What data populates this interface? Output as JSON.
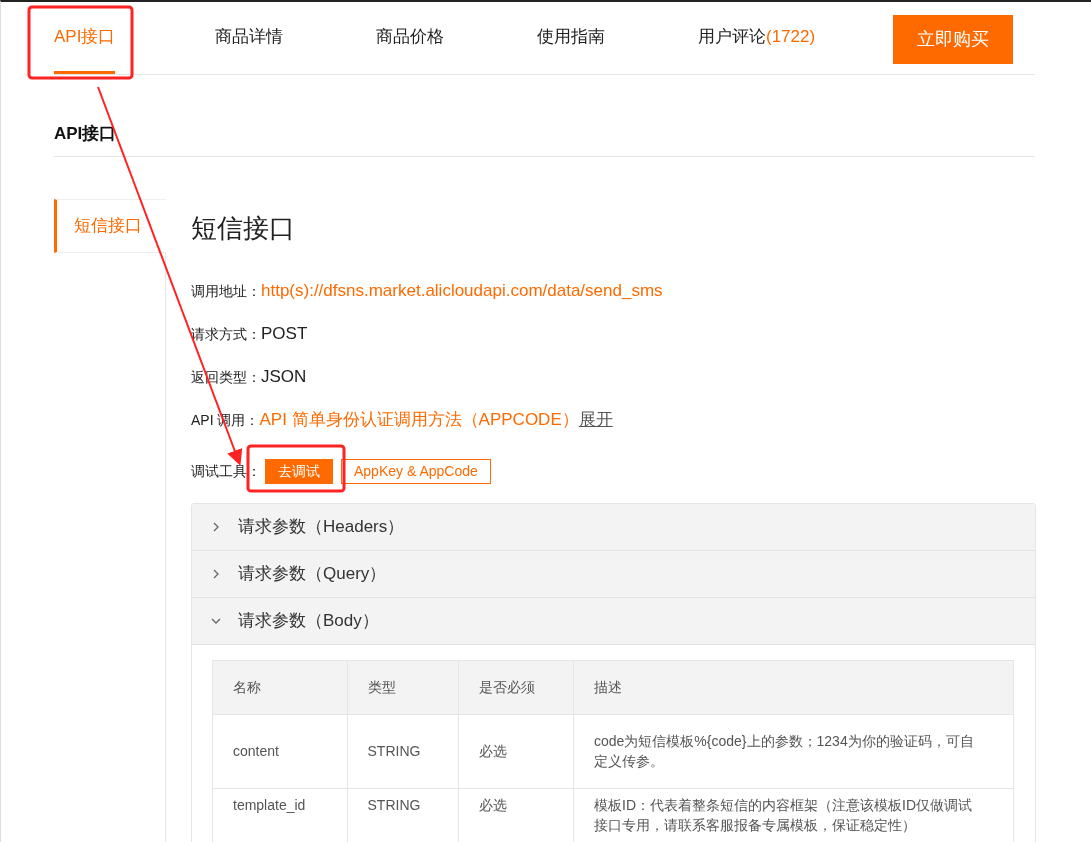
{
  "nav": {
    "tabs": [
      {
        "label": "API接口",
        "selected": true
      },
      {
        "label": "商品详情",
        "selected": false
      },
      {
        "label": "商品价格",
        "selected": false
      },
      {
        "label": "使用指南",
        "selected": false
      },
      {
        "label": "用户评论",
        "count": "(1722)",
        "selected": false
      }
    ],
    "buy_button": "立即购买"
  },
  "section_title": "API接口",
  "sidebar": {
    "items": [
      {
        "label": "短信接口",
        "selected": true
      }
    ]
  },
  "api": {
    "title": "短信接口",
    "fields": [
      {
        "label": "调用地址：",
        "value": "http(s)://dfsns.market.alicloudapi.com/data/send_sms",
        "kind": "link"
      },
      {
        "label": "请求方式：",
        "value": "POST",
        "kind": "text"
      },
      {
        "label": "返回类型：",
        "value": "JSON",
        "kind": "text"
      },
      {
        "label": "API 调用：",
        "value": "API 简单身份认证调用方法（APPCODE）",
        "kind": "link",
        "extra": "展开"
      }
    ],
    "debug_tools": {
      "label": "调试工具：",
      "buttons": [
        {
          "label": "去调试",
          "kind": "primary"
        },
        {
          "label": "AppKey & AppCode",
          "kind": "outline"
        }
      ]
    }
  },
  "accordion": [
    {
      "title": "请求参数（Headers）",
      "expanded": false
    },
    {
      "title": "请求参数（Query）",
      "expanded": false
    },
    {
      "title": "请求参数（Body）",
      "expanded": true
    }
  ],
  "table": {
    "columns": [
      "名称",
      "类型",
      "是否必须",
      "描述"
    ],
    "rows": [
      [
        "content",
        "STRING",
        "必选",
        "code为短信模板%{code}上的参数；1234为你的验证码，可自定义传参。"
      ],
      [
        "template_id",
        "STRING",
        "必选",
        "模板ID：代表着整条短信的内容框架（注意该模板ID仅做调试接口专用，请联系客服报备专属模板，保证稳定性）"
      ]
    ]
  }
}
